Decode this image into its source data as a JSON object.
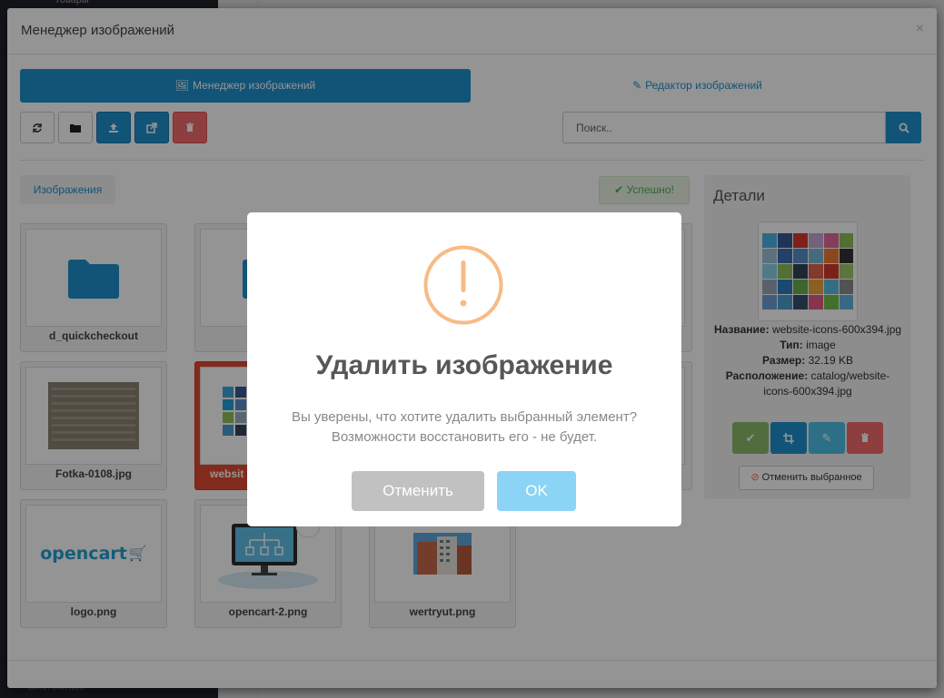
{
  "background": {
    "sidebar_top_text": "Товары",
    "sidebar_bottom_text": "Системные"
  },
  "modal": {
    "title": "Менеджер изображений",
    "close_glyph": "×",
    "tabs": [
      {
        "label": "Менеджер изображений",
        "icon": "image-icon",
        "active": true
      },
      {
        "label": "Редактор изображений",
        "icon": "edit-icon",
        "active": false
      }
    ],
    "toolbar": {
      "refresh_icon": "refresh-icon",
      "folder_icon": "folder-icon",
      "upload_icon": "upload-icon",
      "external_icon": "external-link-icon",
      "delete_icon": "trash-icon"
    },
    "search": {
      "placeholder": "Поиск..",
      "value": ""
    },
    "breadcrumb": "Изображения",
    "status": "Успешно!",
    "files": [
      {
        "name": "d_quickcheckout",
        "type": "folder"
      },
      {
        "name": "",
        "type": "folder"
      },
      {
        "name": "Fotka-0108.jpg",
        "type": "image"
      },
      {
        "name": "websit",
        "type": "image",
        "selected": true
      },
      {
        "name": "logo.png",
        "type": "image"
      },
      {
        "name": "opencart-2.png",
        "type": "image"
      },
      {
        "name": "wertryut.png",
        "type": "image"
      }
    ],
    "details": {
      "title": "Детали",
      "name_label": "Название",
      "name_value": "website-icons-600x394.jpg",
      "type_label": "Тип",
      "type_value": "image",
      "size_label": "Размер",
      "size_value": "32.19 KB",
      "location_label": "Расположение",
      "location_value": "catalog/website-icons-600x394.jpg",
      "deselect_label": "Отменить выбранное"
    }
  },
  "dialog": {
    "title": "Удалить изображение",
    "text_line1": "Вы уверены, что хотите удалить выбранный элемент?",
    "text_line2": "Возможности восстановить его - не будет.",
    "cancel_label": "Отменить",
    "ok_label": "OK"
  },
  "colors": {
    "primary": "#1e91cf",
    "danger": "#f56b6b",
    "success": "#8fbb6c",
    "warning": "#f8bb86",
    "confirm": "#8cd4f5"
  },
  "logo_text": "opencart"
}
